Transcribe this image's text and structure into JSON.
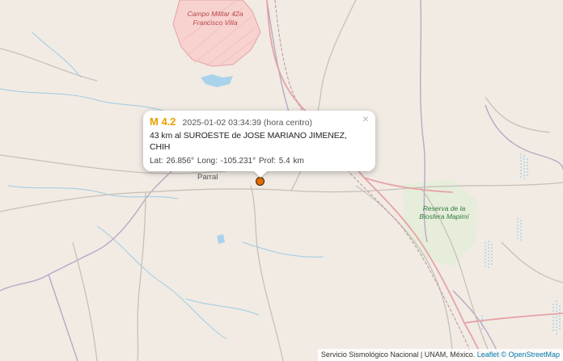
{
  "map": {
    "labels": {
      "campo_militar": "Campo Militar 42a Francisco Villa",
      "parral": "Parral",
      "reserva": "Reserva de la Biosfera Mapimí"
    },
    "colors": {
      "land": "#f1ebe4",
      "military_zone": "#f7d2cf",
      "protected_area": "#e1eed5",
      "water": "#a9d3ea",
      "river": "#9ccbe3",
      "state_border": "#b8a9c4",
      "road": "#c7c0b8",
      "highway": "#e6a3a6",
      "railway": "#c596a8",
      "marker": "#e36b00"
    }
  },
  "popup": {
    "magnitude": "M 4.2",
    "datetime": "2025-01-02   03:34:39 (hora centro)",
    "location": "43 km al SUROESTE de JOSE MARIANO JIMENEZ, CHIH",
    "coordinates": "Lat: 26.856°   Long: -105.231°   Prof: 5.4 km",
    "close_symbol": "×"
  },
  "attribution": {
    "source": "Servicio Sismológico Nacional | UNAM, México.",
    "leaflet": "Leaflet",
    "osm": "© OpenStreetMap"
  }
}
